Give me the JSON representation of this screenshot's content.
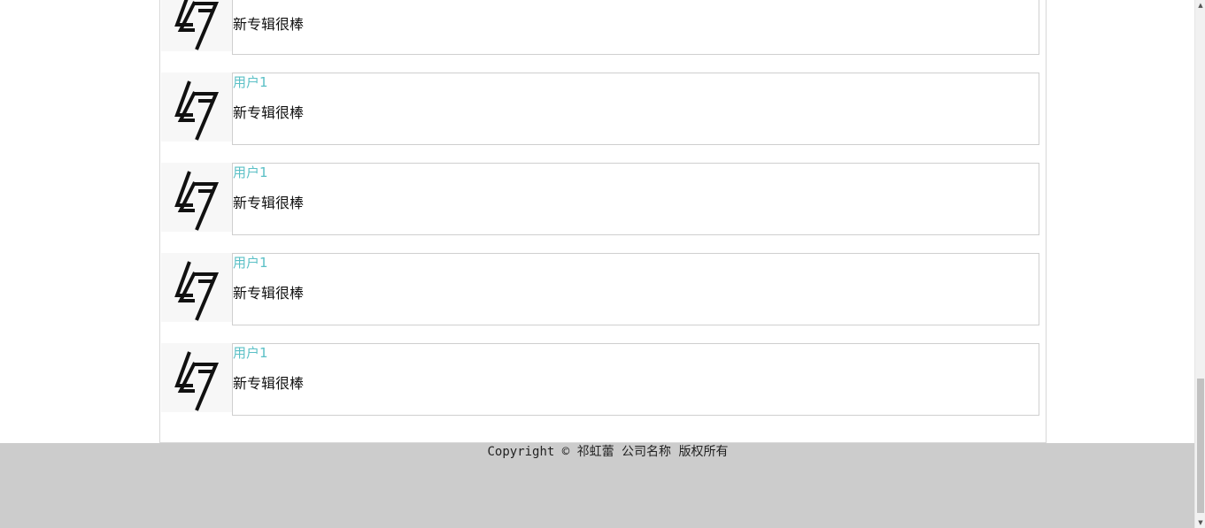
{
  "comments": [
    {
      "user": "",
      "text": "新专辑很棒"
    },
    {
      "user": "用户1",
      "text": "新专辑很棒"
    },
    {
      "user": "用户1",
      "text": "新专辑很棒"
    },
    {
      "user": "用户1",
      "text": "新专辑很棒"
    },
    {
      "user": "用户1",
      "text": "新专辑很棒"
    }
  ],
  "avatar_icon": "logo-47-icon",
  "footer": {
    "copyright": "Copyright © 祁虹蕾 公司名称 版权所有"
  },
  "colors": {
    "username": "#5bc0c6",
    "footer_bg": "#cccccc",
    "border": "#cfcfcf"
  }
}
